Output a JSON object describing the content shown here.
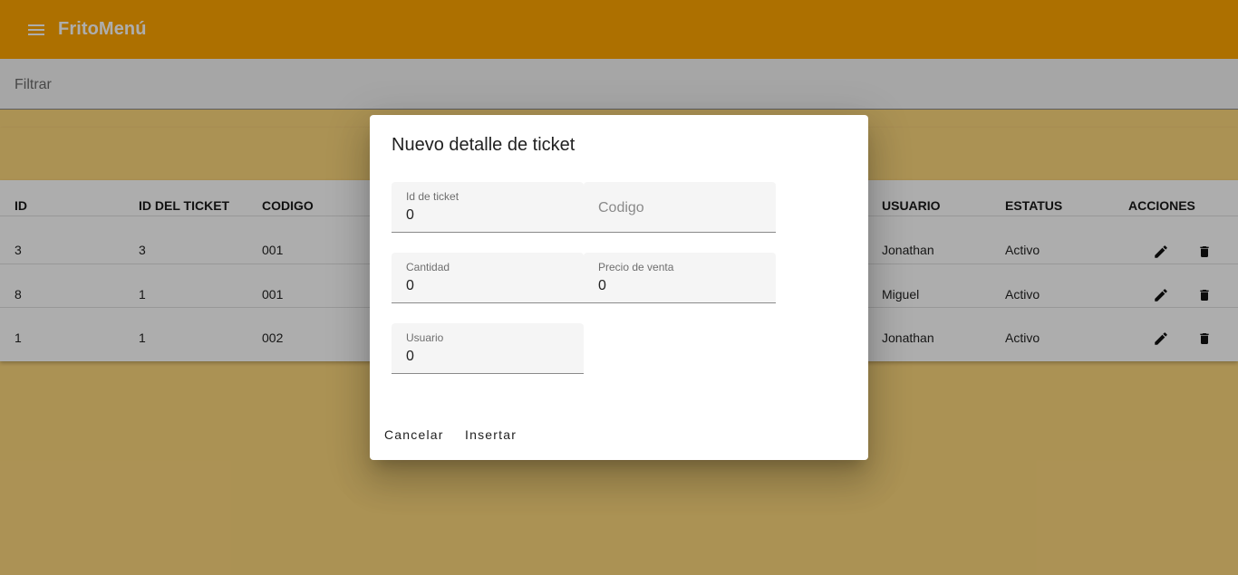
{
  "app": {
    "title": "FritoMenú",
    "accent": "#FFA500"
  },
  "filter": {
    "placeholder": "Filtrar",
    "value": ""
  },
  "table": {
    "headers": [
      "ID",
      "ID DEL TICKET",
      "CODIGO",
      "USUARIO",
      "ESTATUS",
      "ACCIONES"
    ],
    "rows": [
      {
        "id": "3",
        "ticket": "3",
        "codigo": "001",
        "usuario": "Jonathan",
        "estatus": "Activo"
      },
      {
        "id": "8",
        "ticket": "1",
        "codigo": "001",
        "usuario": "Miguel",
        "estatus": "Activo"
      },
      {
        "id": "1",
        "ticket": "1",
        "codigo": "002",
        "usuario": "Jonathan",
        "estatus": "Activo"
      }
    ],
    "icons": {
      "edit": "pencil-icon",
      "delete": "trash-icon"
    }
  },
  "dialog": {
    "title": "Nuevo detalle de ticket",
    "fields": {
      "ticket": {
        "label": "Id de ticket",
        "value": "0"
      },
      "codigo": {
        "placeholder": "Codigo",
        "value": ""
      },
      "cantidad": {
        "label": "Cantidad",
        "value": "0"
      },
      "precio": {
        "label": "Precio de venta",
        "value": "0"
      },
      "usuario": {
        "label": "Usuario",
        "value": "0"
      }
    },
    "buttons": {
      "cancel": "Cancelar",
      "insert": "Insertar"
    }
  },
  "icons": {
    "menu": "hamburger-menu-icon"
  }
}
